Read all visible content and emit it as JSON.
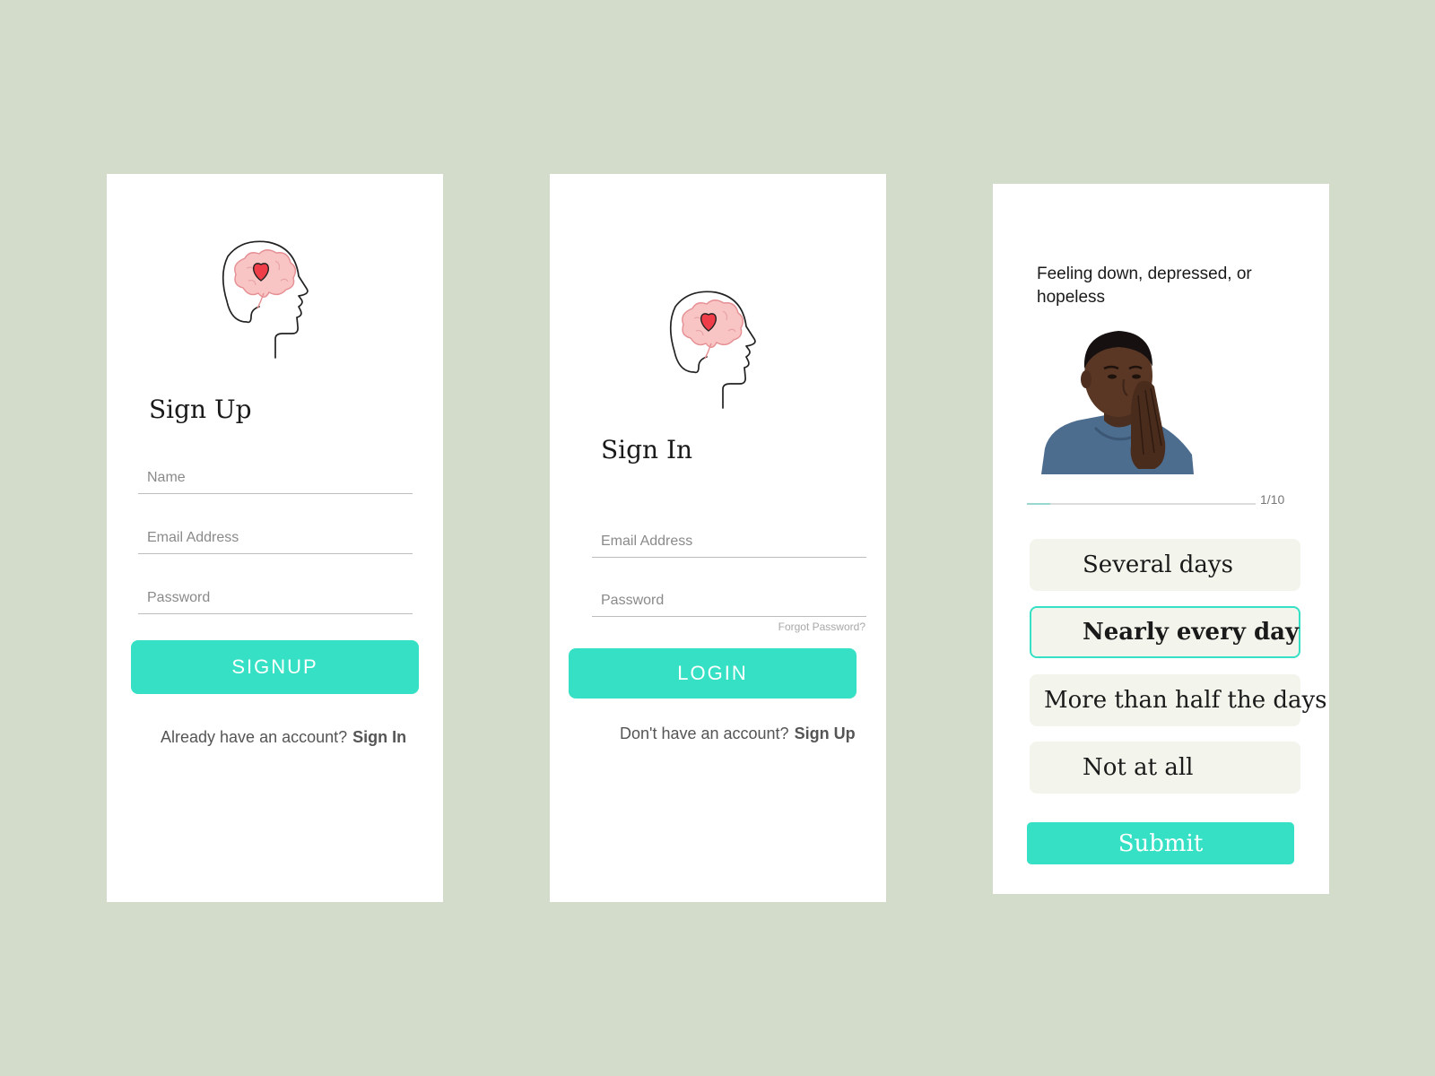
{
  "colors": {
    "background": "#d3dbcb",
    "accent": "#36e0c5",
    "option_bg": "#f3f5ec"
  },
  "signup": {
    "logo_icon": "brain-heart-head-icon",
    "title": "Sign Up",
    "fields": {
      "name_placeholder": "Name",
      "email_placeholder": "Email Address",
      "password_placeholder": "Password"
    },
    "button_label": "SIGNUP",
    "switch_prompt": "Already have an account?",
    "switch_link": "Sign In"
  },
  "signin": {
    "logo_icon": "brain-heart-head-icon",
    "title": "Sign In",
    "fields": {
      "email_placeholder": "Email Address",
      "password_placeholder": "Password"
    },
    "forgot_label": "Forgot Password?",
    "button_label": "LOGIN",
    "switch_prompt": "Don't have an account?",
    "switch_link": "Sign Up"
  },
  "quiz": {
    "question": "Feeling down, depressed, or hopeless",
    "photo_icon": "sad-man-photo",
    "progress": {
      "text": "1/10",
      "fraction": 0.1
    },
    "options": [
      {
        "label": "Several days",
        "selected": false
      },
      {
        "label": "Nearly every day",
        "selected": true
      },
      {
        "label": "More than half the days",
        "selected": false
      },
      {
        "label": "Not at all",
        "selected": false
      }
    ],
    "submit_label": "Submit"
  }
}
